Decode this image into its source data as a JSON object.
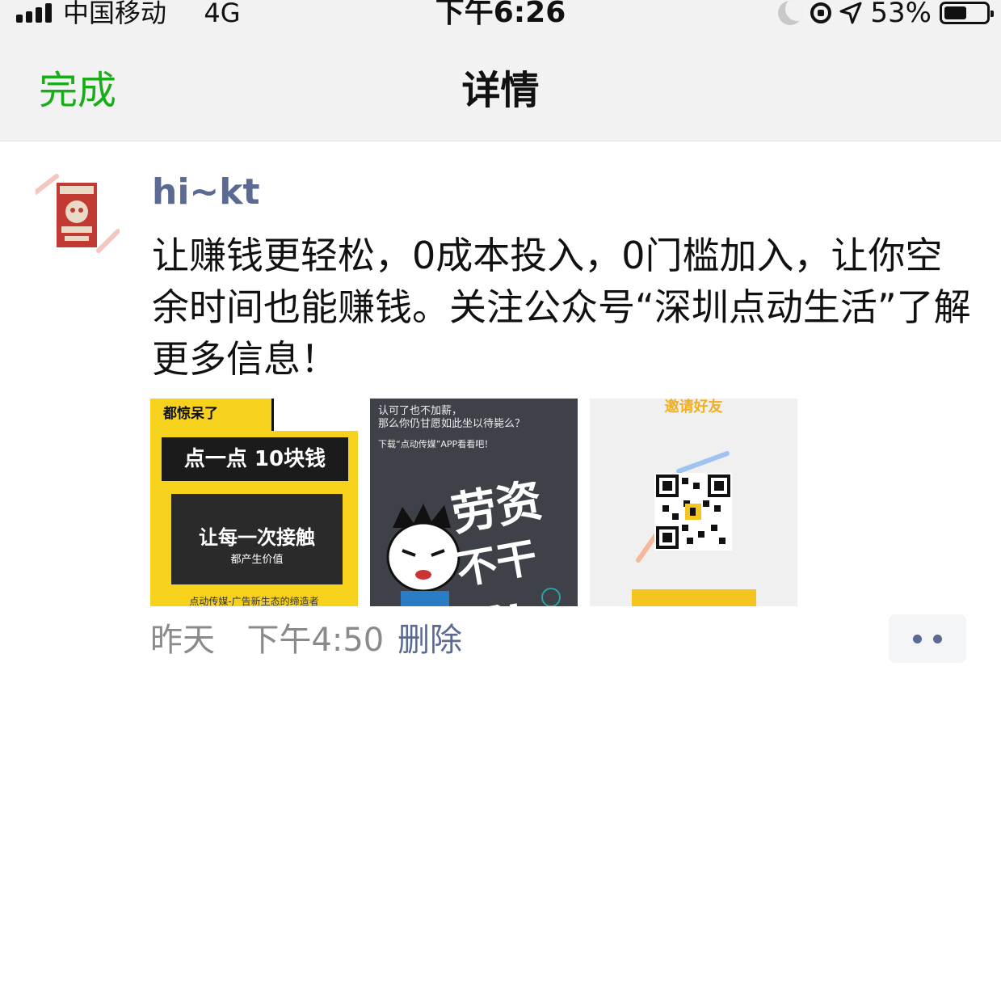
{
  "status_bar": {
    "carrier": "中国移动",
    "network": "4G",
    "time": "下午6:26",
    "battery_percent": "53%",
    "battery_level": 0.53,
    "icons": [
      "signal-icon",
      "moon-icon",
      "rotation-lock-icon",
      "location-icon",
      "battery-icon"
    ]
  },
  "nav": {
    "done_label": "完成",
    "title": "详情"
  },
  "post": {
    "username": "hi~kt",
    "text": "让赚钱更轻松，0成本投入，0门槛加入，让你空余时间也能赚钱。关注公众号“深圳点动生活”了解更多信息！",
    "images": [
      {
        "lines": [
          "都惊呆了",
          "点一点 10块钱",
          "让每一次接触",
          "都产生价值",
          "点动传媒-广告新生态的缔造者"
        ]
      },
      {
        "lines": [
          "认可了也不加薪，",
          "那么你仍甘愿如此坐以待毙么？",
          "下载“点动传媒”APP看看吧！",
          "劳资",
          "不干了!"
        ]
      },
      {
        "lines": [
          "邀请好友"
        ]
      }
    ],
    "date": "昨天",
    "time": "下午4:50",
    "delete_label": "删除"
  },
  "colors": {
    "accent_green": "#1aad19",
    "link_blue": "#5b6a92",
    "nav_bg": "#f2f2f2"
  }
}
